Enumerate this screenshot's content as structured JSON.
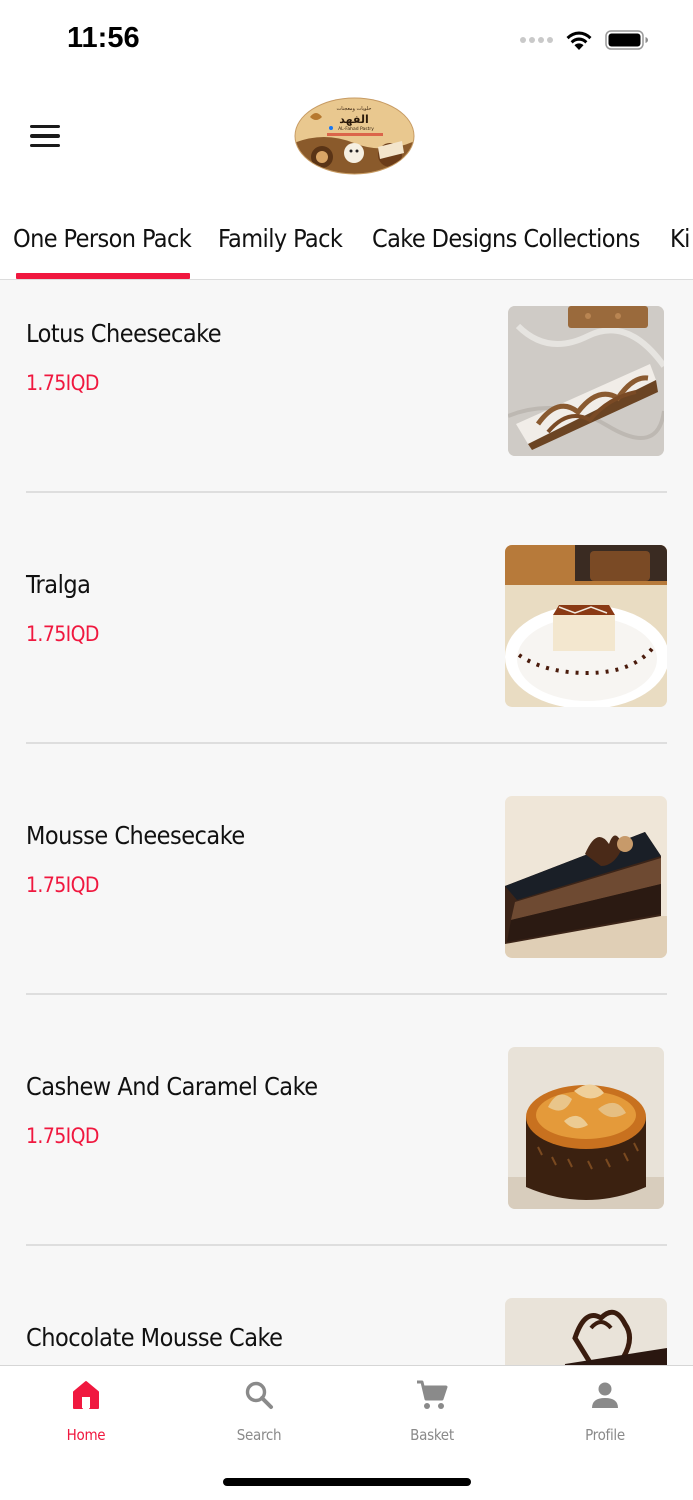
{
  "status_bar": {
    "time": "11:56",
    "icons": [
      "signal-icon",
      "wifi-icon",
      "battery-icon"
    ]
  },
  "header": {
    "menu_icon": "hamburger-menu-icon",
    "logo_text_arabic": "الفهد",
    "logo_text": "AL-Fahad Pastry"
  },
  "tabs": [
    {
      "label": "One Person Pack",
      "active": true
    },
    {
      "label": "Family Pack",
      "active": false
    },
    {
      "label": "Cake Designs Collections",
      "active": false
    },
    {
      "label": "Ki",
      "active": false
    }
  ],
  "products": [
    {
      "name": "Lotus Cheesecake",
      "price": "1.75IQD"
    },
    {
      "name": "Tralga",
      "price": "1.75IQD"
    },
    {
      "name": "Mousse Cheesecake",
      "price": "1.75IQD"
    },
    {
      "name": "Cashew And Caramel Cake",
      "price": "1.75IQD"
    },
    {
      "name": "Chocolate Mousse Cake",
      "price": ""
    }
  ],
  "bottom_nav": [
    {
      "label": "Home",
      "icon": "home-icon",
      "active": true
    },
    {
      "label": "Search",
      "icon": "search-icon",
      "active": false
    },
    {
      "label": "Basket",
      "icon": "cart-icon",
      "active": false
    },
    {
      "label": "Profile",
      "icon": "person-icon",
      "active": false
    }
  ],
  "colors": {
    "accent": "#f0183f",
    "background": "#f7f7f7",
    "inactive": "#8a8a8a"
  }
}
